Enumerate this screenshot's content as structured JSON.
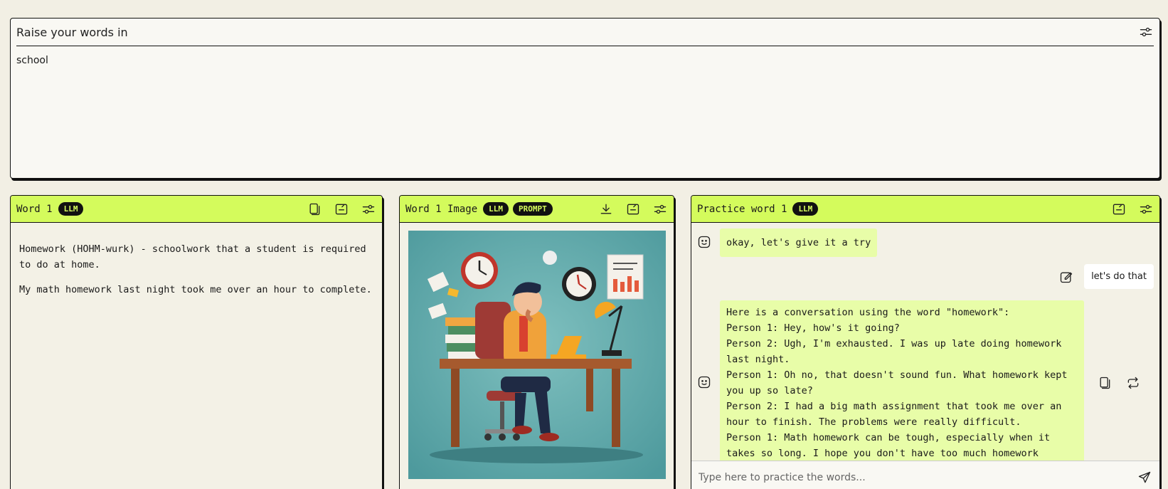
{
  "top": {
    "title": "Raise your words in",
    "topic": "school"
  },
  "word_card": {
    "title": "Word 1",
    "badge": "LLM",
    "definition": "Homework (HOHM-wurk) - schoolwork that a student is required to do at home.",
    "example": "My math homework last night took me over an hour to complete."
  },
  "image_card": {
    "title": "Word 1 Image",
    "badges": [
      "LLM",
      "PROMPT"
    ]
  },
  "practice_card": {
    "title": "Practice word 1",
    "badge": "LLM",
    "messages": [
      {
        "role": "bot",
        "text": "okay, let's give it a try"
      },
      {
        "role": "user",
        "text": "let's do that"
      },
      {
        "role": "bot",
        "lines": [
          "Here is a conversation using the word \"homework\":",
          "Person 1: Hey, how's it going?",
          "Person 2: Ugh, I'm exhausted. I was up late doing homework last night.",
          "Person 1: Oh no, that doesn't sound fun. What homework kept you up so late?",
          "Person 2: I had a big math assignment that took me over an hour to finish. The problems were really difficult.",
          "Person 1: Math homework can be tough, especially when it takes so long. I hope you don't have too much homework"
        ]
      }
    ],
    "input_placeholder": "Type here to practice the words..."
  },
  "colors": {
    "accent": "#d4fb5c",
    "bot_bubble": "#e8fda8",
    "background": "#f2efe4"
  }
}
